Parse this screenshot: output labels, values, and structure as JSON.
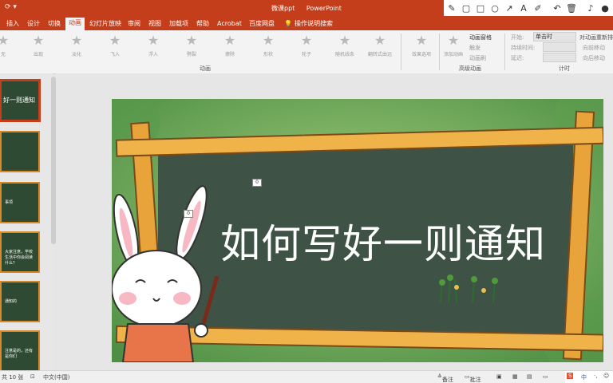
{
  "window": {
    "file_name": "微课ppt",
    "app_name": "PowerPoint"
  },
  "tabs": [
    {
      "label": "插入"
    },
    {
      "label": "设计"
    },
    {
      "label": "切换"
    },
    {
      "label": "动画"
    },
    {
      "label": "幻灯片放映"
    },
    {
      "label": "审阅"
    },
    {
      "label": "视图"
    },
    {
      "label": "加载项"
    },
    {
      "label": "帮助"
    },
    {
      "label": "Acrobat"
    },
    {
      "label": "百度网盘"
    },
    {
      "label": "操作说明搜索"
    }
  ],
  "ribbon": {
    "animations": [
      "无",
      "出现",
      "淡化",
      "飞入",
      "浮入",
      "劈裂",
      "擦除",
      "形状",
      "轮子",
      "随机线条",
      "翻转式由远"
    ],
    "effect_options": "效果选项",
    "add_animation": "添加动画",
    "animation_pane": "动画窗格",
    "trigger": "触发",
    "animation_painter": "动画刷",
    "advanced_group": "高级动画",
    "animation_group": "动画",
    "start_label": "开始:",
    "start_value": "单击时",
    "duration_label": "持续时间:",
    "delay_label": "延迟:",
    "reorder_title": "对动画重新排序",
    "move_earlier": "向前移动",
    "move_later": "向后移动",
    "timing_group": "计时"
  },
  "slide": {
    "title": "如何写好一则通知",
    "tag_a": "0",
    "tag_b": "0"
  },
  "thumbnails": [
    {
      "text": "好一则通知"
    },
    {
      "text": ""
    },
    {
      "text": "事项"
    },
    {
      "text": "大家注意，学校生活中你会阅读什么？"
    },
    {
      "text": "通知的"
    },
    {
      "text": "注意是的，还有是你们"
    }
  ],
  "status": {
    "slide_count": "共 10 张",
    "language": "中文(中国)",
    "notes": "备注",
    "comments": "批注",
    "ime": "中"
  },
  "colors": {
    "accent": "#c43e1c",
    "chalkboard": "#3e5346",
    "frame": "#e8a33a"
  }
}
